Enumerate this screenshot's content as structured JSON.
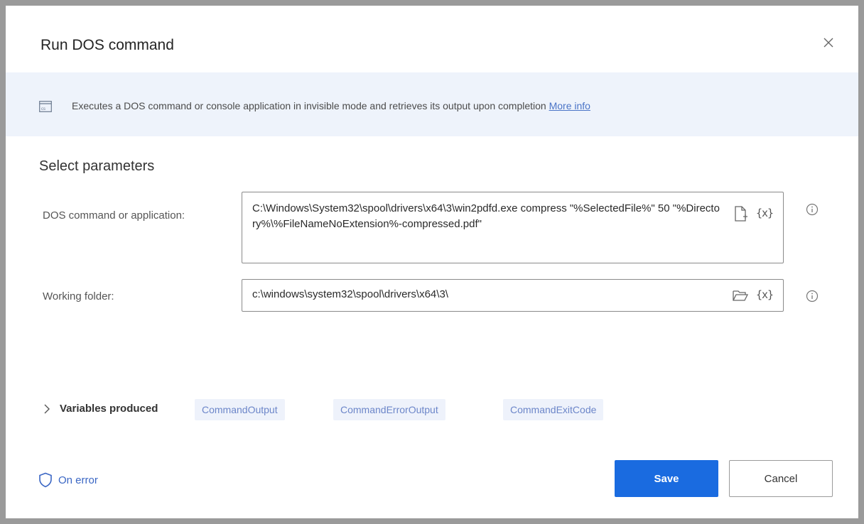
{
  "dialog": {
    "title": "Run DOS command",
    "close_icon": "close-icon"
  },
  "banner": {
    "icon": "console-window-icon",
    "text": "Executes a DOS command or console application in invisible mode and retrieves its output upon completion ",
    "link": "More info"
  },
  "section": {
    "title": "Select parameters"
  },
  "fields": {
    "command": {
      "label": "DOS command or application:",
      "value": "C:\\Windows\\System32\\spool\\drivers\\x64\\3\\win2pdfd.exe compress \"%SelectedFile%\" 50 \"%Directory%\\%FileNameNoExtension%-compressed.pdf\"",
      "file_icon": "file-picker-icon",
      "variable_label": "{x}",
      "info_icon": "info-icon"
    },
    "working_folder": {
      "label": "Working folder:",
      "value": "c:\\windows\\system32\\spool\\drivers\\x64\\3\\",
      "folder_icon": "folder-picker-icon",
      "variable_label": "{x}",
      "info_icon": "info-icon"
    }
  },
  "variables": {
    "label": "Variables produced",
    "items": [
      "CommandOutput",
      "CommandErrorOutput",
      "CommandExitCode"
    ]
  },
  "footer": {
    "on_error_label": "On error",
    "save_label": "Save",
    "cancel_label": "Cancel"
  },
  "colors": {
    "primary": "#1a6be0",
    "banner_bg": "#eef3fb",
    "chip_bg": "#eef2fb",
    "link": "#3a66c4"
  }
}
